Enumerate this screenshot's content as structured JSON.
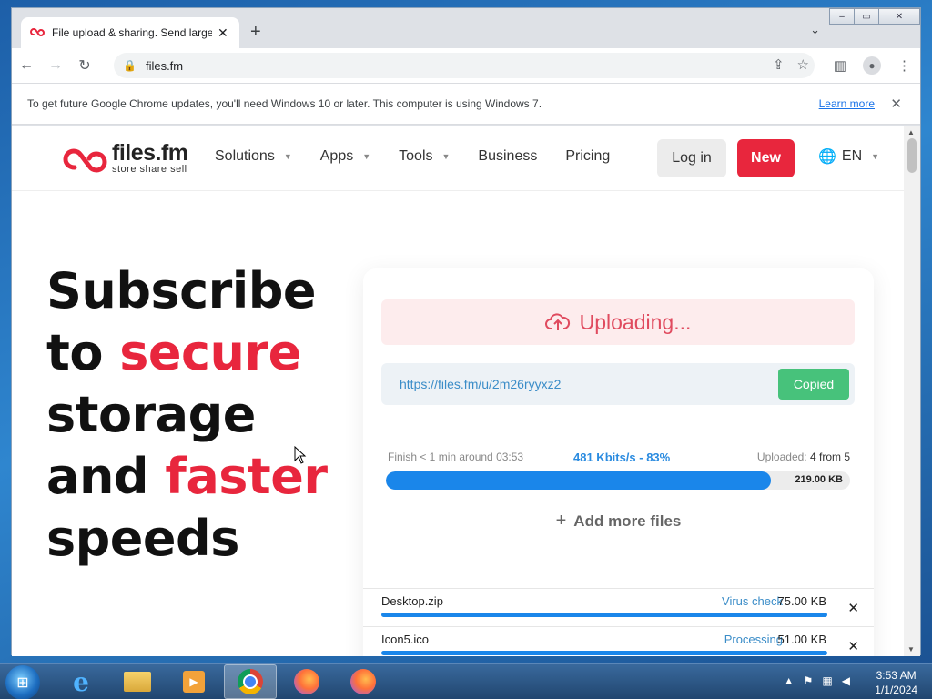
{
  "browser": {
    "tab_title": "File upload & sharing. Send large",
    "url": "files.fm",
    "infobar_text": "To get future Google Chrome updates, you'll need Windows 10 or later. This computer is using Windows 7.",
    "infobar_link": "Learn more"
  },
  "site": {
    "logo_name": "files.fm",
    "logo_tagline": "store  share  sell",
    "nav": [
      {
        "label": "Solutions"
      },
      {
        "label": "Apps"
      },
      {
        "label": "Tools"
      },
      {
        "label": "Business"
      },
      {
        "label": "Pricing"
      }
    ],
    "login_label": "Log in",
    "new_label": "New",
    "lang_label": "EN"
  },
  "hero": {
    "l1": "Subscribe",
    "l2a": "to ",
    "l2b": "secure",
    "l3": "storage",
    "l4a": "and ",
    "l4b": "faster",
    "l5": "speeds"
  },
  "upload": {
    "status": "Uploading...",
    "link": "https://files.fm/u/2m26ryyxz2",
    "copied_label": "Copied",
    "finish_text": "Finish < 1 min around 03:53",
    "speed_text": "481 Kbits/s - 83%",
    "uploaded_label": "Uploaded:",
    "uploaded_value": "4 from 5",
    "progress_percent": 83,
    "progress_size": "219.00 KB",
    "add_more": "Add more files"
  },
  "files": [
    {
      "name": "Desktop.zip",
      "status": "Virus check",
      "size": "75.00 KB",
      "progress": 100
    },
    {
      "name": "Icon5.ico",
      "status": "Processing",
      "size": "51.00 KB",
      "progress": 100
    }
  ],
  "taskbar": {
    "time": "3:53 AM",
    "date": "1/1/2024"
  },
  "colors": {
    "brand_red": "#e8263d",
    "progress_blue": "#1a86ea",
    "copied_green": "#47c27b"
  }
}
